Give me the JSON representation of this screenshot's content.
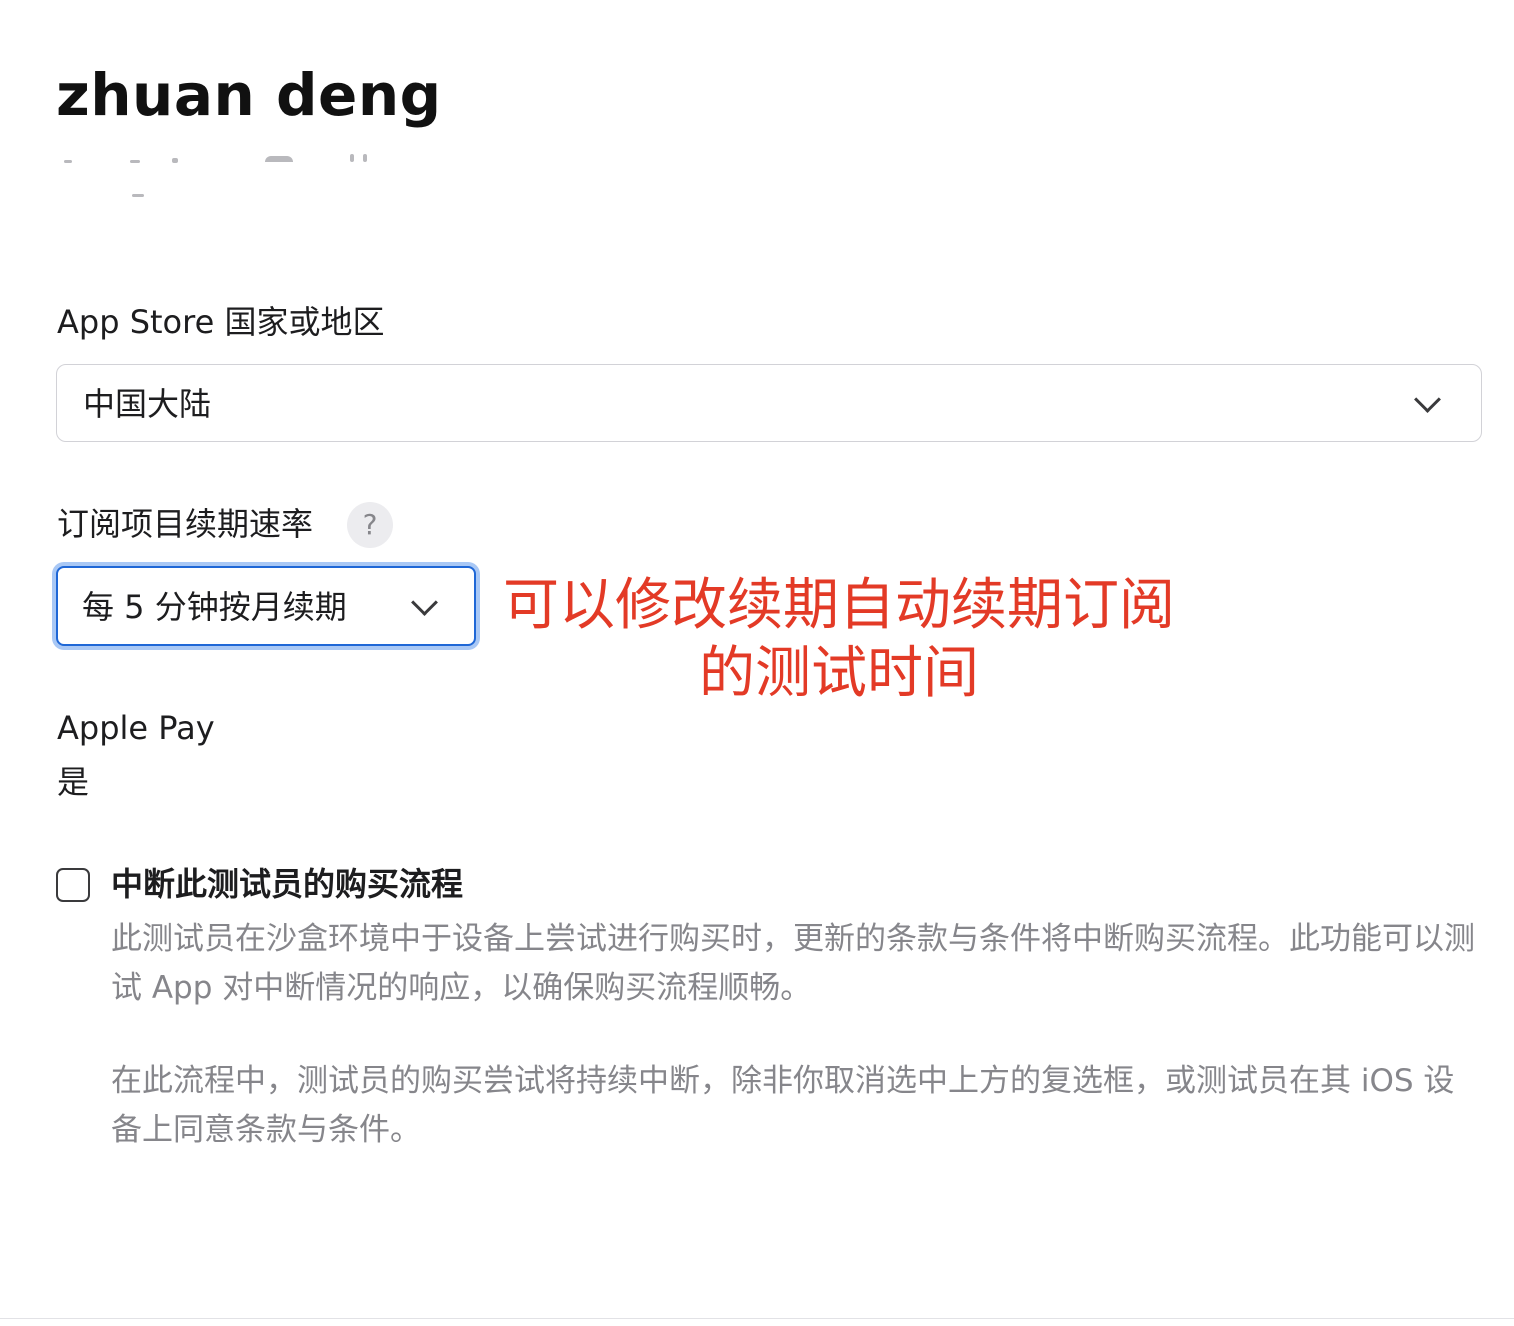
{
  "profile": {
    "name": "zhuan deng"
  },
  "app_store_region": {
    "label": "App Store 国家或地区",
    "selected": "中国大陆"
  },
  "renewal_rate": {
    "label": "订阅项目续期速率",
    "help": "?",
    "selected": "每 5 分钟按月续期"
  },
  "annotation": {
    "line1": "可以修改续期自动续期订阅",
    "line2": "的测试时间",
    "color": "#e33a26"
  },
  "apple_pay": {
    "label": "Apple Pay",
    "value": "是"
  },
  "interrupt_purchase": {
    "label": "中断此测试员的购买流程",
    "checked": false,
    "description_1": "此测试员在沙盒环境中于设备上尝试进行购买时，更新的条款与条件将中断购买流程。此功能可以测试 App 对中断情况的响应，以确保购买流程顺畅。",
    "description_2": "在此流程中，测试员的购买尝试将持续中断，除非你取消选中上方的复选框，或测试员在其 iOS 设备上同意条款与条件。"
  },
  "colors": {
    "focus_ring": "#1f67d6",
    "secondary_text": "#86868b"
  }
}
